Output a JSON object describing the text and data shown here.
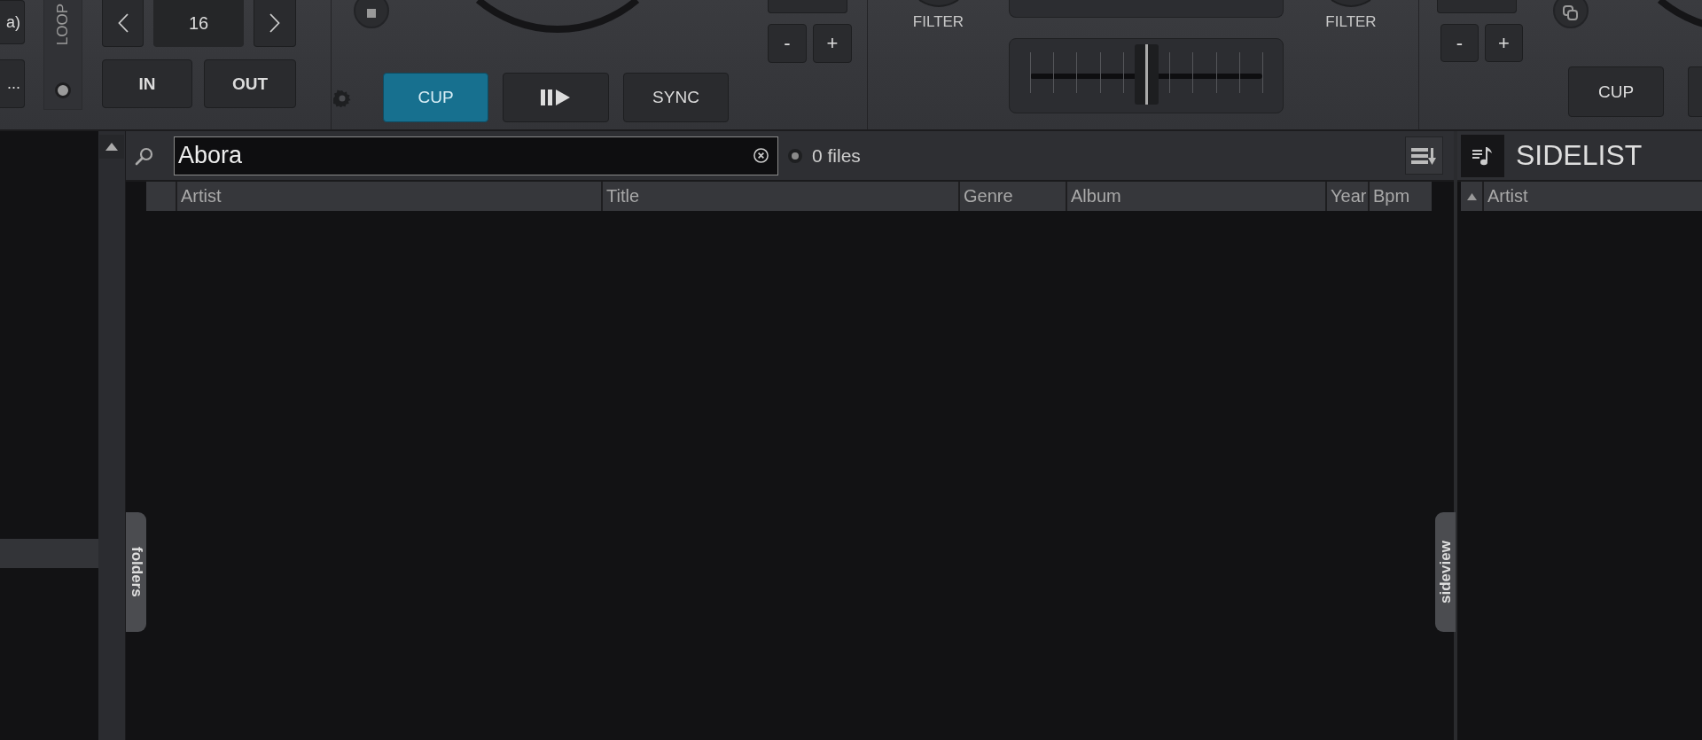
{
  "deck_left": {
    "buttons": [
      "a)",
      "..."
    ],
    "loop_label": "LOOP",
    "loop_length": "16",
    "in": "IN",
    "out": "OUT",
    "cue": {
      "label": "CUP",
      "active": true
    },
    "sync": "SYNC",
    "pitch_buttons": [
      "-",
      "+"
    ]
  },
  "mixer": {
    "filters": [
      "FILTER",
      "FILTER"
    ],
    "crossfader": {
      "level": 0.5
    }
  },
  "deck_right": {
    "pitch_buttons": [
      "-",
      "+"
    ],
    "cue": {
      "label": "CUP",
      "active": false
    }
  },
  "browser": {
    "search": {
      "value": "Abora"
    },
    "file_count": "0 files",
    "columns": [
      "Artist",
      "Title",
      "Genre",
      "Album",
      "Year",
      "Bpm"
    ],
    "folders_tab": "folders",
    "sideview_tab": "sideview"
  },
  "sidelist": {
    "title": "SIDELIST",
    "columns": [
      "Artist"
    ]
  }
}
